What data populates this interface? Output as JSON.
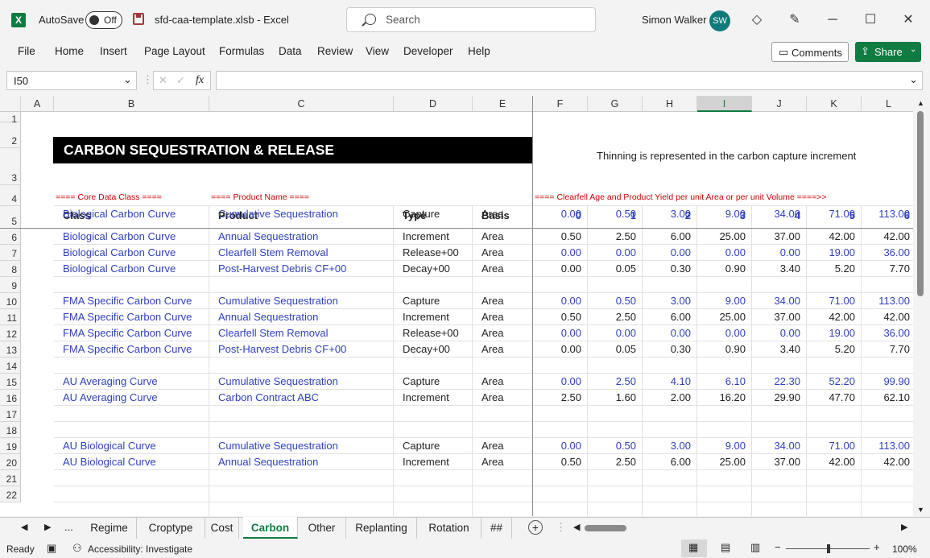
{
  "titlebar": {
    "autosave": "AutoSave",
    "autosave_state": "Off",
    "filename": "sfd-caa-template.xlsb  -  Excel",
    "search_placeholder": "Search",
    "user": "Simon Walker",
    "avatar": "SW"
  },
  "menu": [
    "File",
    "Home",
    "Insert",
    "Page Layout",
    "Formulas",
    "Data",
    "Review",
    "View",
    "Developer",
    "Help"
  ],
  "buttons": {
    "comments": "Comments",
    "share": "Share"
  },
  "formulabar": {
    "namebox": "I50",
    "fx": "fx",
    "formula": ""
  },
  "columns": [
    "A",
    "B",
    "C",
    "D",
    "E",
    "F",
    "G",
    "H",
    "I",
    "J",
    "K",
    "L"
  ],
  "rows": [
    "1",
    "2",
    "3",
    "4",
    "5",
    "6",
    "7",
    "8",
    "9",
    "10",
    "11",
    "12",
    "13",
    "14",
    "15",
    "16",
    "17",
    "18",
    "19",
    "20",
    "21",
    "22"
  ],
  "sheet": {
    "banner": "CARBON SEQUESTRATION & RELEASE",
    "note": "Thinning is represented in the carbon capture increment",
    "section_class": "==== Core Data Class ====",
    "section_product": "==== Product Name ====",
    "section_age": "==== Clearfell Age and Product Yield per unit Area or per unit Volume ====>>",
    "headers": {
      "class": "Class",
      "product": "Product",
      "type": "Type",
      "basis": "Basis",
      "ages": [
        "0",
        "1",
        "2",
        "3",
        "4",
        "5",
        "6"
      ]
    },
    "data": [
      {
        "row": 5,
        "class": "Biological Carbon Curve",
        "product": "Cumulative Sequestration",
        "type": "Capture",
        "basis": "Area",
        "blue": true,
        "v": [
          "0.00",
          "0.50",
          "3.00",
          "9.00",
          "34.00",
          "71.00",
          "113.00"
        ]
      },
      {
        "row": 6,
        "class": "Biological Carbon Curve",
        "product": "Annual Sequestration",
        "type": "Increment",
        "basis": "Area",
        "blue": false,
        "v": [
          "0.50",
          "2.50",
          "6.00",
          "25.00",
          "37.00",
          "42.00",
          "42.00"
        ]
      },
      {
        "row": 7,
        "class": "Biological Carbon Curve",
        "product": "Clearfell Stem Removal",
        "type": "Release+00",
        "basis": "Area",
        "blue": true,
        "v": [
          "0.00",
          "0.00",
          "0.00",
          "0.00",
          "0.00",
          "19.00",
          "36.00"
        ]
      },
      {
        "row": 8,
        "class": "Biological Carbon Curve",
        "product": "Post-Harvest Debris CF+00",
        "type": "Decay+00",
        "basis": "Area",
        "blue": false,
        "v": [
          "0.00",
          "0.05",
          "0.30",
          "0.90",
          "3.40",
          "5.20",
          "7.70"
        ]
      },
      {
        "row": 10,
        "class": "FMA Specific Carbon Curve",
        "product": "Cumulative Sequestration",
        "type": "Capture",
        "basis": "Area",
        "blue": true,
        "v": [
          "0.00",
          "0.50",
          "3.00",
          "9.00",
          "34.00",
          "71.00",
          "113.00"
        ]
      },
      {
        "row": 11,
        "class": "FMA Specific Carbon Curve",
        "product": "Annual Sequestration",
        "type": "Increment",
        "basis": "Area",
        "blue": false,
        "v": [
          "0.50",
          "2.50",
          "6.00",
          "25.00",
          "37.00",
          "42.00",
          "42.00"
        ]
      },
      {
        "row": 12,
        "class": "FMA Specific Carbon Curve",
        "product": "Clearfell Stem Removal",
        "type": "Release+00",
        "basis": "Area",
        "blue": true,
        "v": [
          "0.00",
          "0.00",
          "0.00",
          "0.00",
          "0.00",
          "19.00",
          "36.00"
        ]
      },
      {
        "row": 13,
        "class": "FMA Specific Carbon Curve",
        "product": "Post-Harvest Debris CF+00",
        "type": "Decay+00",
        "basis": "Area",
        "blue": false,
        "v": [
          "0.00",
          "0.05",
          "0.30",
          "0.90",
          "3.40",
          "5.20",
          "7.70"
        ]
      },
      {
        "row": 15,
        "class": "AU Averaging Curve",
        "product": "Cumulative Sequestration",
        "type": "Capture",
        "basis": "Area",
        "blue": true,
        "v": [
          "0.00",
          "2.50",
          "4.10",
          "6.10",
          "22.30",
          "52.20",
          "99.90"
        ]
      },
      {
        "row": 16,
        "class": "AU Averaging Curve",
        "product": "Carbon Contract ABC",
        "type": "Increment",
        "basis": "Area",
        "blue": false,
        "v": [
          "2.50",
          "1.60",
          "2.00",
          "16.20",
          "29.90",
          "47.70",
          "62.10"
        ]
      },
      {
        "row": 19,
        "class": "AU Biological Curve",
        "product": "Cumulative Sequestration",
        "type": "Capture",
        "basis": "Area",
        "blue": true,
        "v": [
          "0.00",
          "0.50",
          "3.00",
          "9.00",
          "34.00",
          "71.00",
          "113.00"
        ]
      },
      {
        "row": 20,
        "class": "AU Biological Curve",
        "product": "Annual Sequestration",
        "type": "Increment",
        "basis": "Area",
        "blue": false,
        "v": [
          "0.50",
          "2.50",
          "6.00",
          "25.00",
          "37.00",
          "42.00",
          "42.00"
        ]
      }
    ]
  },
  "tabs": [
    "Regime",
    "Croptype",
    "Cost",
    "Carbon",
    "Other",
    "Replanting",
    "Rotation",
    "##"
  ],
  "active_tab": "Carbon",
  "tab_more": "...",
  "status": {
    "ready": "Ready",
    "accessibility": "Accessibility: Investigate",
    "zoom": "100%"
  }
}
